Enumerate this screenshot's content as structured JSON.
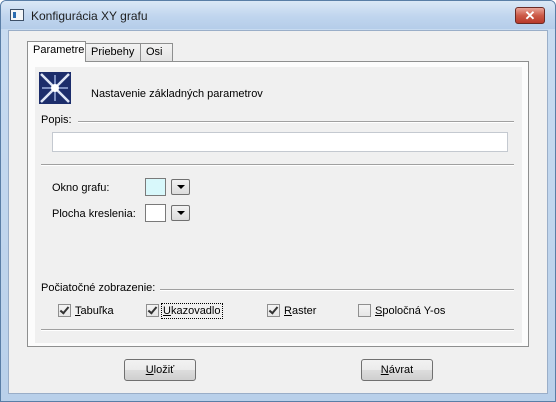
{
  "window": {
    "title": "Konfigurácia XY grafu",
    "close_glyph": "✕"
  },
  "tabs": [
    {
      "label": "Parametre",
      "active": true
    },
    {
      "label": "Priebehy",
      "active": false
    },
    {
      "label": "Osi",
      "active": false
    }
  ],
  "panel": {
    "heading": "Nastavenie základných parametrov",
    "popis_label": "Popis:",
    "popis_value": "",
    "okno_label": "Okno grafu:",
    "okno_color": "#d8f8fb",
    "plocha_label": "Plocha kreslenia:",
    "plocha_color": "#ffffff",
    "initial_label": "Počiatočné zobrazenie:",
    "checkboxes": [
      {
        "key": "T",
        "rest": "abuľka",
        "checked": true
      },
      {
        "key": "U",
        "rest": "kazovadlo",
        "checked": true
      },
      {
        "key": "R",
        "rest": "aster",
        "checked": true
      },
      {
        "key": "S",
        "rest": "poločná Y-os",
        "checked": false
      }
    ]
  },
  "buttons": {
    "save": {
      "key": "U",
      "rest": "ložiť"
    },
    "back": {
      "key": "N",
      "rest": "ávrat"
    }
  },
  "icons": {
    "app": "app-window-icon",
    "logo": "chart-config-logo-icon",
    "dropdown": "chevron-down-icon"
  }
}
